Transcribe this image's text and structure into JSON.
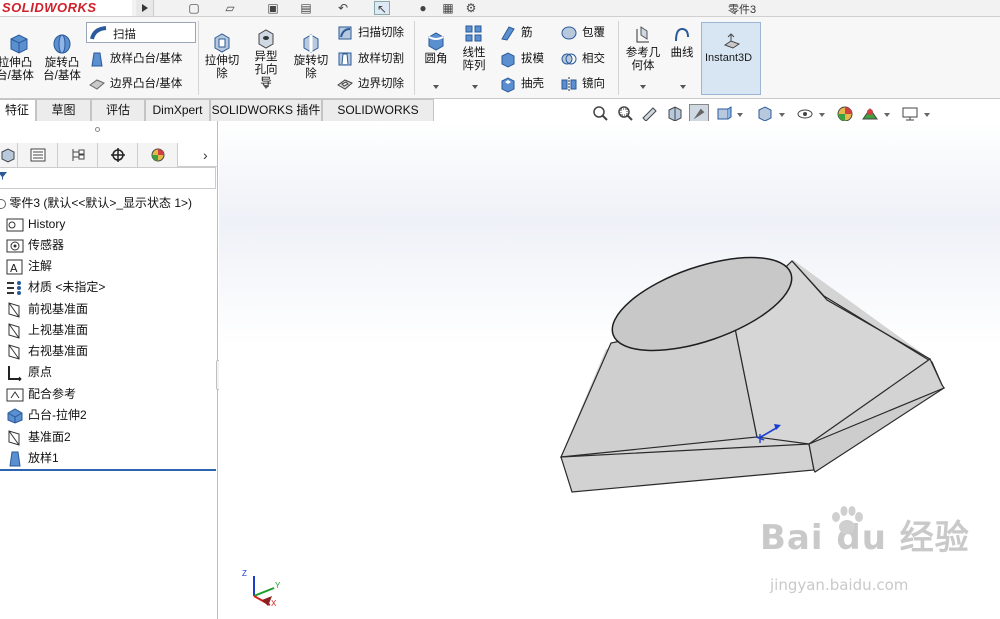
{
  "app": {
    "logo": "SOLIDWORKS",
    "doc_title": "零件3"
  },
  "ribbon": {
    "extrude_boss": "拉伸凸台/基体",
    "revolve_boss": "旋转凸台/基体",
    "sweep": "扫描",
    "loft_boss": "放样凸台/基体",
    "boundary_boss": "边界凸台/基体",
    "extrude_cut": "拉伸切除",
    "hole_wizard": "异型孔向导",
    "revolve_cut": "旋转切除",
    "swept_cut": "扫描切除",
    "lofted_cut": "放样切割",
    "boundary_cut": "边界切除",
    "fillet": "圆角",
    "linear_pattern": "线性阵列",
    "rib": "筋",
    "draft": "拔模",
    "shell": "抽壳",
    "wrap": "包覆",
    "intersect": "相交",
    "mirror": "镜向",
    "reference_geometry": "参考几何体",
    "curves": "曲线",
    "instant3d": "Instant3D"
  },
  "tabs": [
    "特征",
    "草图",
    "评估",
    "DimXpert",
    "SOLIDWORKS 插件",
    "SOLIDWORKS MBD"
  ],
  "tree": {
    "root": "零件3  (默认<<默认>_显示状态 1>)",
    "items": [
      "History",
      "传感器",
      "注解",
      "材质 <未指定>",
      "前视基准面",
      "上视基准面",
      "右视基准面",
      "原点",
      "配合参考",
      "凸台-拉伸2",
      "基准面2",
      "放样1"
    ]
  },
  "triad": {
    "z": "Z",
    "y": "Y",
    "x": "X"
  },
  "watermark": {
    "main": "Bai du 经验",
    "sub": "jingyan.baidu.com"
  },
  "colors": {
    "accent": "#2c64b0",
    "model_fill": "#d4d4d4",
    "logo_red": "#d0202a"
  }
}
